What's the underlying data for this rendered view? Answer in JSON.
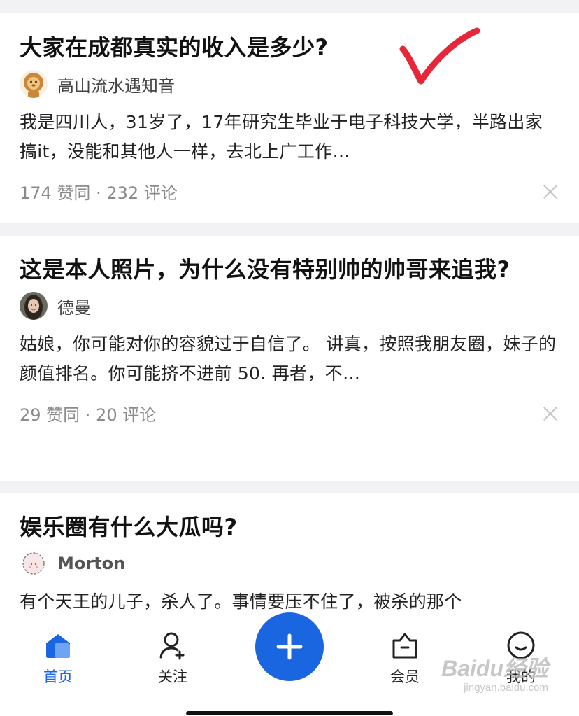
{
  "feed": {
    "cards": [
      {
        "title": "大家在成都真实的收入是多少?",
        "author": "高山流水遇知音",
        "avatar_icon": "lion-avatar",
        "excerpt": "我是四川人，31岁了，17年研究生毕业于电子科技大学，半路出家搞it，没能和其他人一样，去北上广工作…",
        "meta": "174 赞同 · 232 评论"
      },
      {
        "title": "这是本人照片，为什么没有特别帅的帅哥来追我?",
        "author": "德曼",
        "avatar_icon": "portrait-avatar",
        "excerpt": "姑娘，你可能对你的容貌过于自信了。 讲真，按照我朋友圈，妹子的颜值排名。你可能挤不进前 50. 再者，不…",
        "meta": "29 赞同 · 20 评论"
      },
      {
        "title": "娱乐圈有什么大瓜吗?",
        "author": "Morton",
        "avatar_icon": "sheep-avatar",
        "excerpt": "有个天王的儿子，杀人了。事情要压不住了，被杀的那个"
      }
    ]
  },
  "tabbar": {
    "home": "首页",
    "follow": "关注",
    "vip": "会员",
    "me": "我的"
  },
  "watermark": {
    "main": "Baidu经验",
    "sub": "jingyan.baidu.com"
  },
  "colors": {
    "accent": "#1a66e0",
    "checkmark": "#e8263a",
    "background": "#f2f2f4"
  }
}
